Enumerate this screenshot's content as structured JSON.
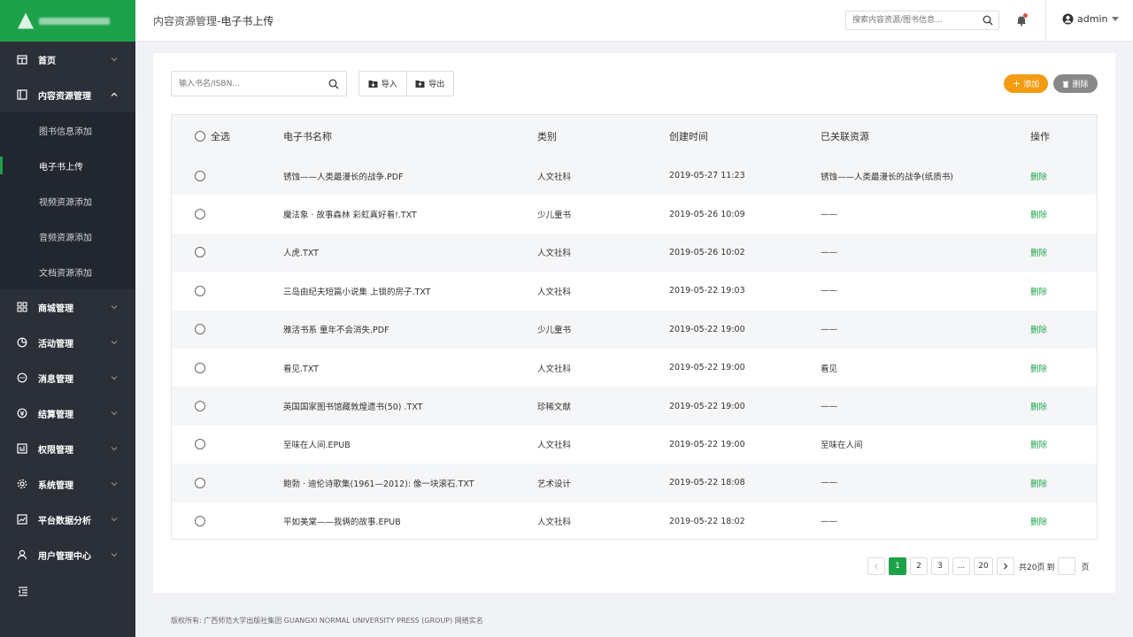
{
  "header": {
    "breadcrumb": "内容资源管理-",
    "title": "电子书上传",
    "search_placeholder": "搜索内容资源/图书信息...",
    "user": "admin"
  },
  "sidebar": {
    "items": [
      {
        "label": "首页",
        "icon": "calendar-icon"
      },
      {
        "label": "内容资源管理",
        "icon": "layout-icon",
        "expanded": true,
        "children": [
          "图书信息添加",
          "电子书上传",
          "视频资源添加",
          "音频资源添加",
          "文档资源添加"
        ],
        "active_child": "电子书上传"
      },
      {
        "label": "商城管理",
        "icon": "grid-icon"
      },
      {
        "label": "活动管理",
        "icon": "pie-icon"
      },
      {
        "label": "消息管理",
        "icon": "message-icon"
      },
      {
        "label": "结算管理",
        "icon": "settle-icon"
      },
      {
        "label": "权限管理",
        "icon": "permission-icon"
      },
      {
        "label": "系统管理",
        "icon": "gear-icon"
      },
      {
        "label": "平台数据分析",
        "icon": "chart-icon"
      },
      {
        "label": "用户管理中心",
        "icon": "user-icon"
      }
    ]
  },
  "toolbar": {
    "search_placeholder": "输入书名/ISBN...",
    "import_label": "导入",
    "export_label": "导出",
    "add_label": "添加",
    "delete_label": "删除"
  },
  "table": {
    "headers": {
      "select_all": "全选",
      "name": "电子书名称",
      "category": "类别",
      "created": "创建时间",
      "related": "已关联资源",
      "action": "操作"
    },
    "rows": [
      {
        "name": "锈蚀——人类最漫长的战争.PDF",
        "category": "人文社科",
        "created": "2019-05-27 11:23",
        "related": "锈蚀——人类最漫长的战争(纸质书)",
        "action": "删除"
      },
      {
        "name": "魔法象 · 故事森林 彩虹真好看!.TXT",
        "category": "少儿童书",
        "created": "2019-05-26 10:09",
        "related": "——",
        "action": "删除"
      },
      {
        "name": "人虎.TXT",
        "category": "人文社科",
        "created": "2019-05-26 10:02",
        "related": "——",
        "action": "删除"
      },
      {
        "name": "三岛由纪夫短篇小说集 上锁的房子.TXT",
        "category": "人文社科",
        "created": "2019-05-22 19:03",
        "related": "——",
        "action": "删除"
      },
      {
        "name": "雅活书系 童年不会消失.PDF",
        "category": "少儿童书",
        "created": "2019-05-22 19:00",
        "related": "——",
        "action": "删除"
      },
      {
        "name": "看见.TXT",
        "category": "人文社科",
        "created": "2019-05-22 19:00",
        "related": "看见",
        "action": "删除"
      },
      {
        "name": "英国国家图书馆藏敦煌遗书(50) .TXT",
        "category": "珍稀文献",
        "created": "2019-05-22 19:00",
        "related": "——",
        "action": "删除"
      },
      {
        "name": "至味在人间.EPUB",
        "category": "人文社科",
        "created": "2019-05-22 19:00",
        "related": "至味在人间",
        "action": "删除"
      },
      {
        "name": "鲍勃 · 迪伦诗歌集(1961—2012): 像一块滚石.TXT",
        "category": "艺术设计",
        "created": "2019-05-22 18:08",
        "related": "——",
        "action": "删除"
      },
      {
        "name": "平如美棠——我俩的故事.EPUB",
        "category": "人文社科",
        "created": "2019-05-22 18:02",
        "related": "——",
        "action": "删除"
      }
    ]
  },
  "pagination": {
    "pages": [
      "1",
      "2",
      "3",
      "...",
      "20"
    ],
    "current": "1",
    "total_text": "共20页",
    "goto_text": "到",
    "unit": "页"
  },
  "footer": {
    "text": "版权所有: 广西师范大学出版社集团 GUANGXI NORMAL UNIVERSITY PRESS (GROUP)   网络实名"
  },
  "colors": {
    "brand": "#1ca34a",
    "sidebar": "#2b2f38",
    "add": "#f39c12",
    "delete": "#888888"
  }
}
